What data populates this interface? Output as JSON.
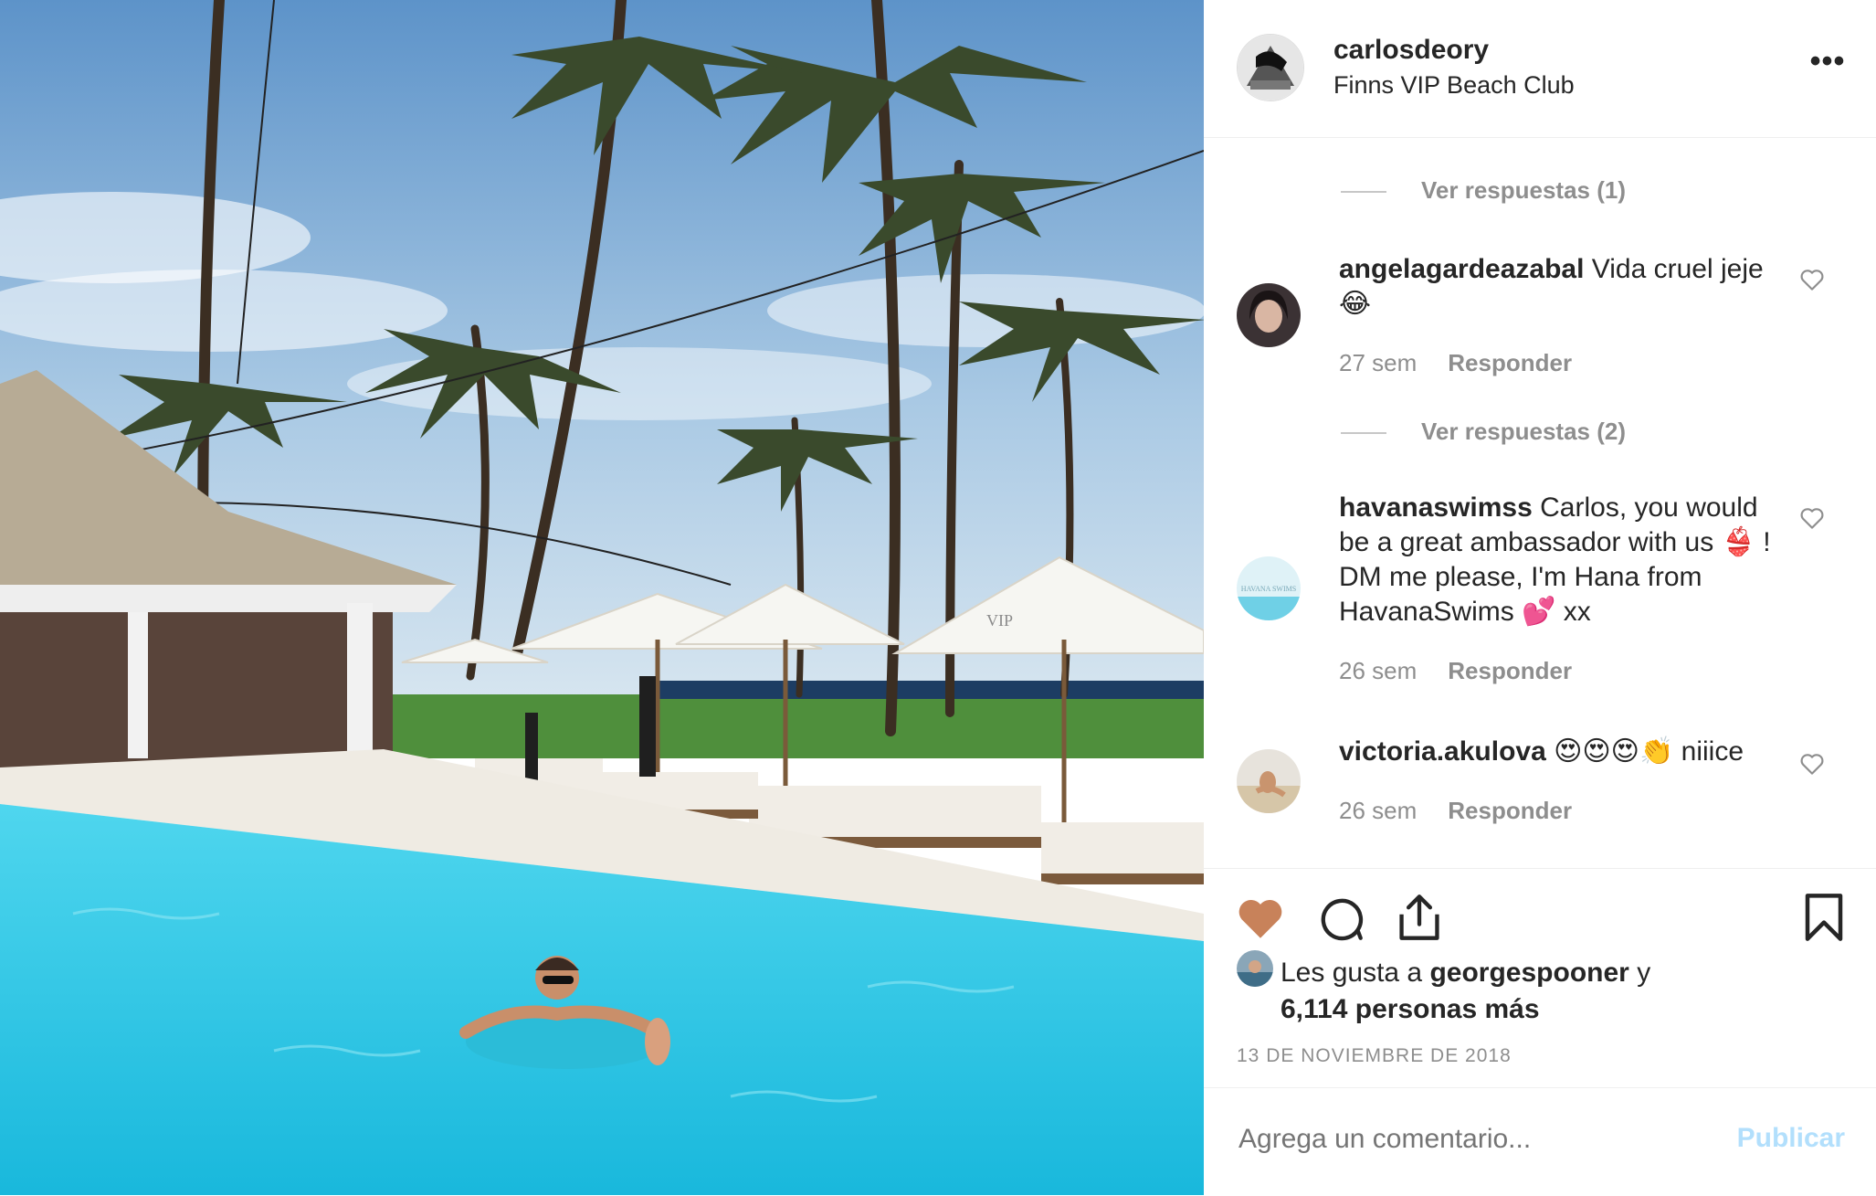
{
  "post": {
    "username": "carlosdeory",
    "location": "Finns VIP Beach Club",
    "more_icon": "•••"
  },
  "comments": [
    {
      "view_replies": "Ver respuestas (1)"
    },
    {
      "username": "angelagardeazabal",
      "text": "Vida cruel jeje 😂",
      "age": "27 sem",
      "reply_label": "Responder"
    },
    {
      "view_replies": "Ver respuestas (2)"
    },
    {
      "username": "havanaswimss",
      "text": "Carlos, you would be a great ambassador with us 👙 ! DM me please, I'm Hana from HavanaSwims 💕  xx",
      "age": "26 sem",
      "reply_label": "Responder"
    },
    {
      "username": "victoria.akulova",
      "text": "😍😍😍👏 niiice",
      "age": "26 sem",
      "reply_label": "Responder"
    }
  ],
  "likes": {
    "prefix": "Les gusta a",
    "user": "georgespooner",
    "conj": "y",
    "others": "6,114 personas más"
  },
  "date": "13 DE NOVIEMBRE DE 2018",
  "add_comment": {
    "placeholder": "Agrega un comentario...",
    "post_label": "Publicar"
  },
  "photo": {
    "avatar_text": "HAVANA SWIMS",
    "umbrella_text": "VIP"
  },
  "colors": {
    "liked_heart": "#c8825a",
    "muted": "#8e8e8e",
    "publish_disabled": "#b2dffc"
  }
}
